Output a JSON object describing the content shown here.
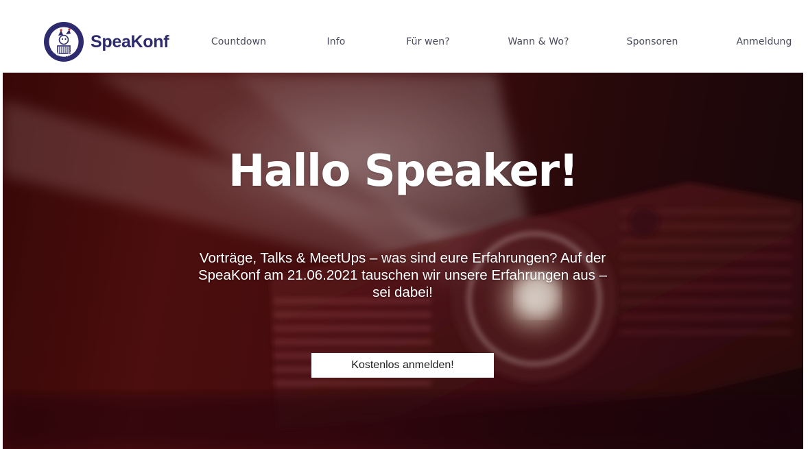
{
  "brand": {
    "name": "SpeaKonf",
    "badge_ring_text": "FÜR DARMSTADT",
    "primary_color": "#2d2a6e"
  },
  "nav": {
    "items": [
      {
        "label": "Countdown"
      },
      {
        "label": "Info"
      },
      {
        "label": "Für wen?"
      },
      {
        "label": "Wann & Wo?"
      },
      {
        "label": "Sponsoren"
      },
      {
        "label": "Anmeldung"
      }
    ]
  },
  "hero": {
    "title": "Hallo Speaker!",
    "text": "Vorträge, Talks & MeetUps – was sind eure Erfahrungen? Auf der SpeaKonf am 21.06.2021 tauschen wir unsere Erfahrungen aus – sei dabei!",
    "cta_label": "Kostenlos anmelden!",
    "background_image": "projector-icon",
    "tint_color": "#4b0d10"
  }
}
